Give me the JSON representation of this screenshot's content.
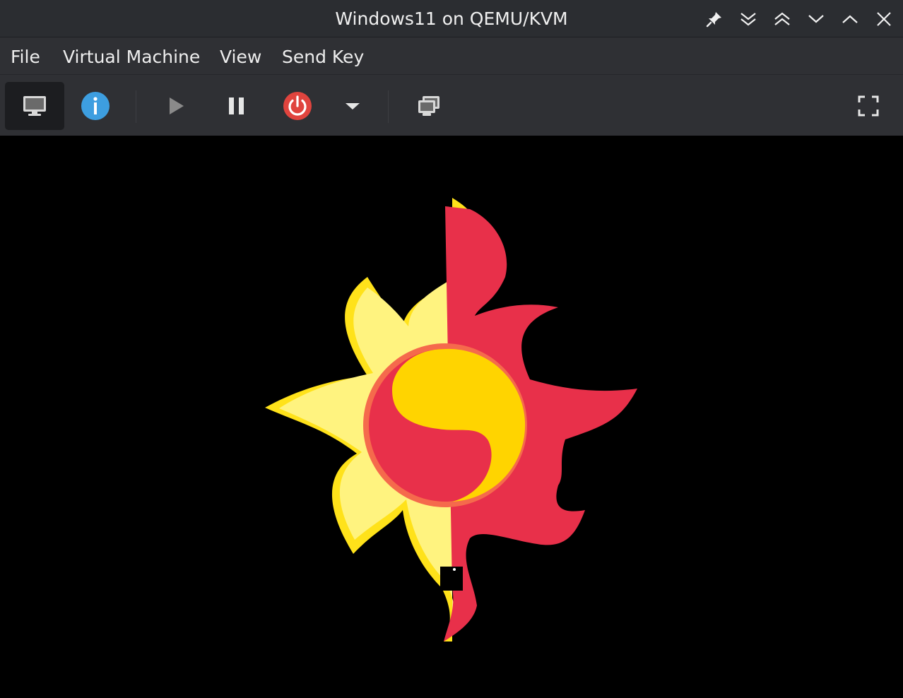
{
  "window": {
    "title": "Windows11 on QEMU/KVM"
  },
  "titlebar_buttons": [
    {
      "name": "pin",
      "icon": "pin-icon"
    },
    {
      "name": "keep-below",
      "icon": "double-chevron-down-icon"
    },
    {
      "name": "keep-above",
      "icon": "double-chevron-up-icon"
    },
    {
      "name": "minimize",
      "icon": "chevron-down-icon"
    },
    {
      "name": "maximize",
      "icon": "chevron-up-icon"
    },
    {
      "name": "close",
      "icon": "close-icon"
    }
  ],
  "menubar": {
    "file": "File",
    "virtual_machine": "Virtual Machine",
    "view": "View",
    "send_key": "Send Key"
  },
  "toolbar": {
    "items": [
      {
        "name": "console",
        "icon": "monitor-icon",
        "active": true
      },
      {
        "name": "details",
        "icon": "info-icon",
        "active": false
      },
      {
        "name": "run",
        "icon": "play-icon",
        "active": false,
        "enabled": false
      },
      {
        "name": "pause",
        "icon": "pause-icon",
        "active": false
      },
      {
        "name": "shutdown",
        "icon": "power-icon",
        "active": false
      },
      {
        "name": "shutdown-menu",
        "icon": "dropdown-arrow-icon",
        "active": false
      },
      {
        "name": "snapshots",
        "icon": "snapshots-icon",
        "active": false
      },
      {
        "name": "fullscreen",
        "icon": "fullscreen-icon",
        "active": false
      }
    ]
  },
  "colors": {
    "titlebar": "#2b2d31",
    "menubar": "#2f3034",
    "info_blue": "#3d9ee0",
    "power_red": "#e0443e",
    "sun_yellow_light": "#fff37f",
    "sun_yellow_outline": "#ffe21a",
    "sun_red": "#e8304a",
    "sun_core_yellow": "#ffd400",
    "sun_core_ring": "#f56a4c"
  },
  "display": {
    "content": "sunset-shimmer-cutie-mark-logo"
  }
}
